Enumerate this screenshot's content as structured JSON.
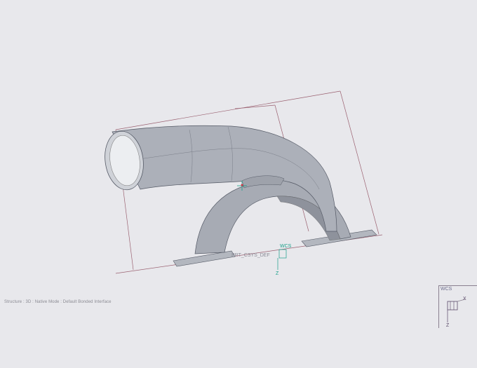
{
  "status_bar": {
    "text": "Structure : 3D : Native Mode : Default Bonded Interface"
  },
  "wcs_indicator": {
    "label": "WCS",
    "x_axis": "X",
    "z_axis": "Z"
  },
  "model": {
    "csys_label": "PRT_CSYS_DEF",
    "csys_wcs": "WCS",
    "z_axis": "Z"
  },
  "colors": {
    "background": "#e8e8ec",
    "part": "#a9adb6",
    "outline": "#9a6070",
    "csys": "#1aa08a"
  }
}
